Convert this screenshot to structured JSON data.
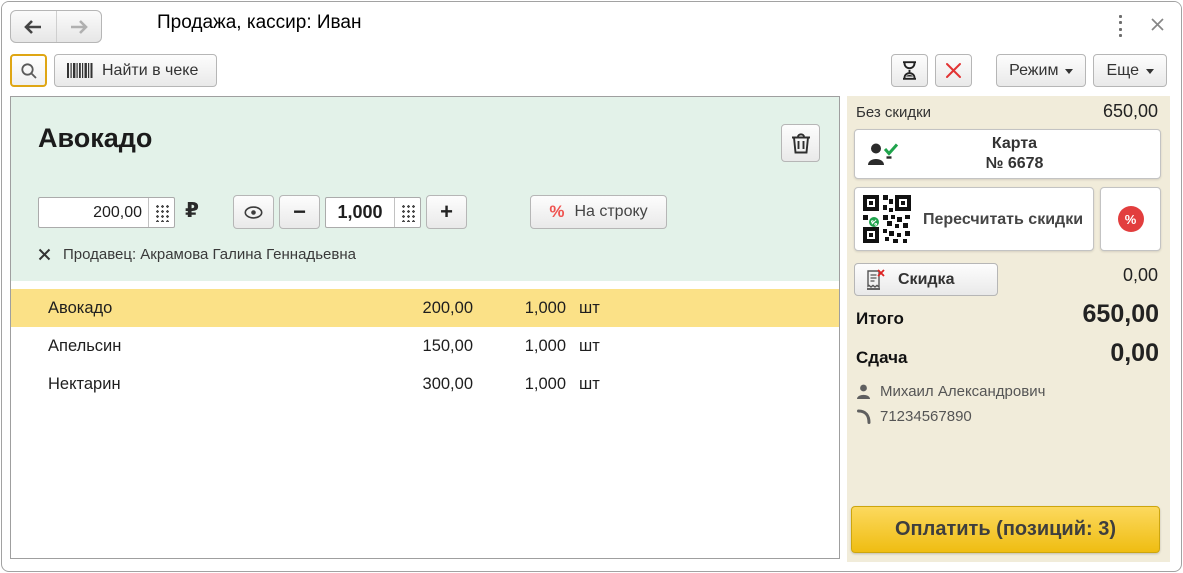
{
  "titlebar": {
    "title": "Продажа, кассир: Иван"
  },
  "toolbar": {
    "find_label": "Найти в чеке",
    "mode_label": "Режим",
    "more_label": "Еще"
  },
  "item_card": {
    "name": "Авокадо",
    "price_value": "200,00",
    "currency_symbol": "₽",
    "minus_symbol": "−",
    "plus_symbol": "+",
    "qty_value": "1,000",
    "percent_symbol": "%",
    "line_discount_label": "На строку",
    "seller_line": "Продавец: Акрамова Галина Геннадьевна"
  },
  "receipt": {
    "items": [
      {
        "name": "Авокадо",
        "price": "200,00",
        "qty": "1,000",
        "unit": "шт"
      },
      {
        "name": "Апельсин",
        "price": "150,00",
        "qty": "1,000",
        "unit": "шт"
      },
      {
        "name": "Нектарин",
        "price": "300,00",
        "qty": "1,000",
        "unit": "шт"
      }
    ]
  },
  "summary": {
    "no_discount_label": "Без скидки",
    "no_discount_value": "650,00",
    "card_label": "Карта",
    "card_number": "№ 6678",
    "recalc_label": "Пересчитать скидки",
    "percent_badge": "%",
    "discount_label": "Скидка",
    "discount_value": "0,00",
    "total_label": "Итого",
    "total_value": "650,00",
    "change_label": "Сдача",
    "change_value": "0,00",
    "customer_name": "Михаил Александрович",
    "customer_phone": "71234567890",
    "pay_label": "Оплатить (позиций: 3)"
  },
  "colors": {
    "panel_green": "#e3f2e9",
    "selection_yellow": "#fbe187",
    "panel_beige": "#f1ecda",
    "pay_yellow": "#f3c629",
    "accent_red": "#e23e3e",
    "check_green": "#1fa34c",
    "search_focus_border": "#dfa614"
  }
}
